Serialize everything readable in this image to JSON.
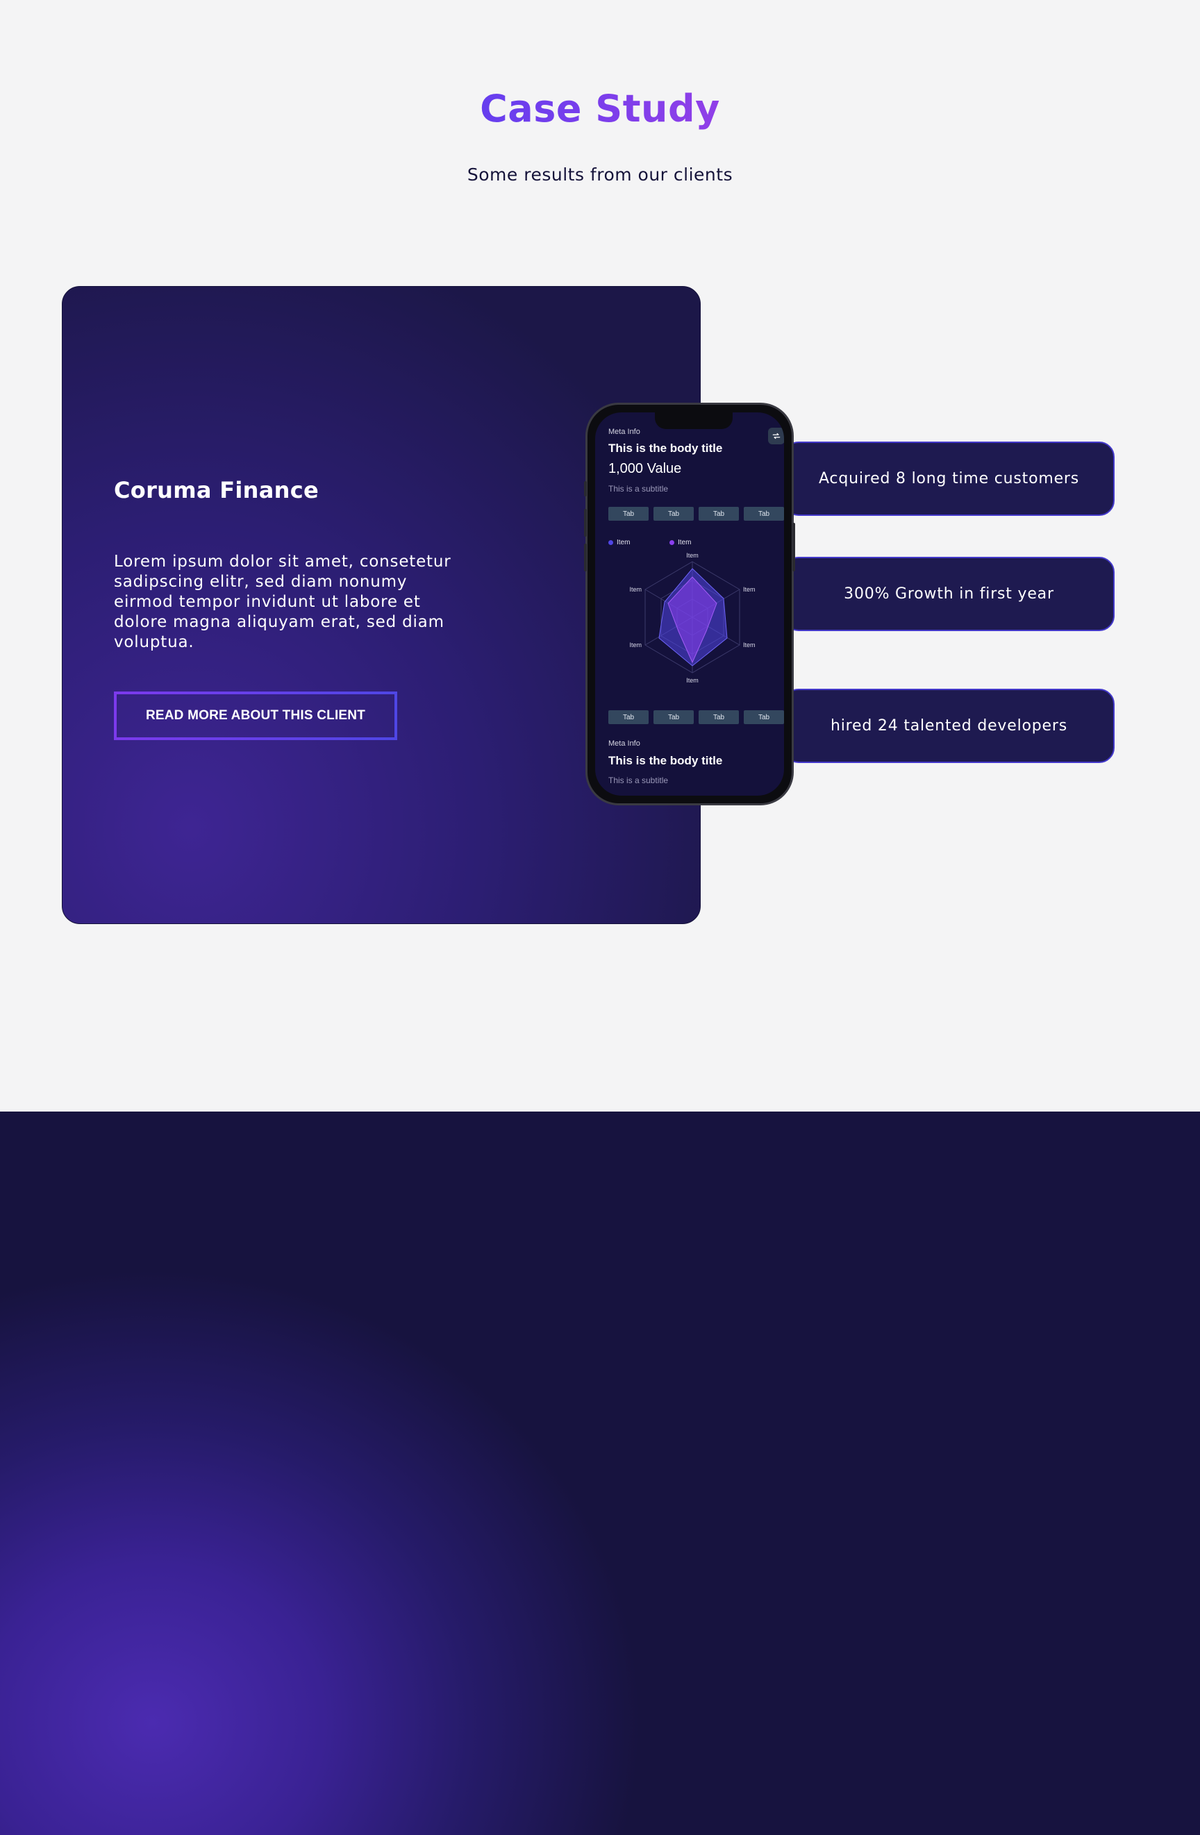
{
  "hero": {
    "title": "Case Study",
    "subtitle": "Some results from our clients"
  },
  "case": {
    "client_name": "Coruma Finance",
    "description": "Lorem ipsum dolor sit amet, consetetur sadipscing elitr, sed diam nonumy eirmod tempor invidunt ut labore et dolore magna aliquyam erat, sed diam voluptua.",
    "button_label": "READ MORE ABOUT THIS CLIENT"
  },
  "stats": [
    {
      "text": "Acquired 8 long time customers"
    },
    {
      "text": "300% Growth in first year"
    },
    {
      "text": "hired 24 talented developers"
    }
  ],
  "phone": {
    "top": {
      "meta": "Meta Info",
      "title": "This is the body title",
      "value": "1,000 Value",
      "subtitle": "This is a subtitle",
      "refresh_icon": "refresh-icon"
    },
    "tabs_top": [
      "Tab",
      "Tab",
      "Tab",
      "Tab"
    ],
    "tabs_bottom": [
      "Tab",
      "Tab",
      "Tab",
      "Tab"
    ],
    "legend": [
      {
        "label": "Item",
        "color": "#5046e5"
      },
      {
        "label": "Item",
        "color": "#8b3ff0"
      }
    ],
    "radar": {
      "axis_labels": [
        "Item",
        "Item",
        "Item",
        "Item",
        "Item",
        "Item"
      ]
    },
    "bottom": {
      "meta": "Meta Info",
      "title": "This is the body title",
      "subtitle": "This is a subtitle"
    }
  },
  "colors": {
    "accent_start": "#5b3ef0",
    "accent_end": "#9b3fe6",
    "card_dark": "#1c1748",
    "stat_border": "#4338ca"
  }
}
